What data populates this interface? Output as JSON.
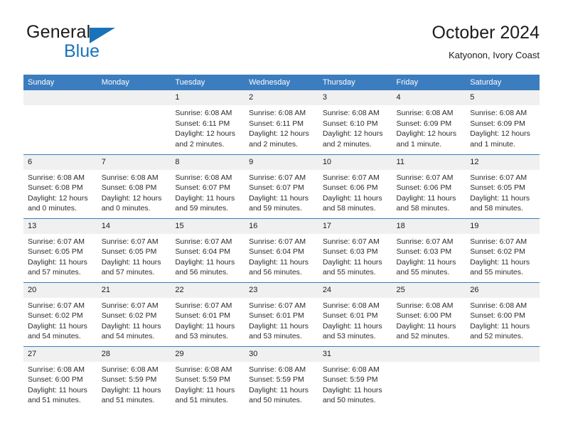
{
  "brand": {
    "name_part1": "General",
    "name_part2": "Blue",
    "triangle_color": "#1a72ba",
    "icon": "triangle-flag-icon"
  },
  "header": {
    "title": "October 2024",
    "subtitle": "Katyonon, Ivory Coast"
  },
  "theme": {
    "header_blue": "#3c7dbf",
    "daynum_band": "#f0f0f0",
    "text": "#1c1c1c"
  },
  "weekday_headers": [
    "Sunday",
    "Monday",
    "Tuesday",
    "Wednesday",
    "Thursday",
    "Friday",
    "Saturday"
  ],
  "weeks": [
    [
      {
        "day": "",
        "sunrise": "",
        "sunset": "",
        "daylight_line1": "",
        "daylight_line2": ""
      },
      {
        "day": "",
        "sunrise": "",
        "sunset": "",
        "daylight_line1": "",
        "daylight_line2": ""
      },
      {
        "day": "1",
        "sunrise": "Sunrise: 6:08 AM",
        "sunset": "Sunset: 6:11 PM",
        "daylight_line1": "Daylight: 12 hours",
        "daylight_line2": "and 2 minutes."
      },
      {
        "day": "2",
        "sunrise": "Sunrise: 6:08 AM",
        "sunset": "Sunset: 6:11 PM",
        "daylight_line1": "Daylight: 12 hours",
        "daylight_line2": "and 2 minutes."
      },
      {
        "day": "3",
        "sunrise": "Sunrise: 6:08 AM",
        "sunset": "Sunset: 6:10 PM",
        "daylight_line1": "Daylight: 12 hours",
        "daylight_line2": "and 2 minutes."
      },
      {
        "day": "4",
        "sunrise": "Sunrise: 6:08 AM",
        "sunset": "Sunset: 6:09 PM",
        "daylight_line1": "Daylight: 12 hours",
        "daylight_line2": "and 1 minute."
      },
      {
        "day": "5",
        "sunrise": "Sunrise: 6:08 AM",
        "sunset": "Sunset: 6:09 PM",
        "daylight_line1": "Daylight: 12 hours",
        "daylight_line2": "and 1 minute."
      }
    ],
    [
      {
        "day": "6",
        "sunrise": "Sunrise: 6:08 AM",
        "sunset": "Sunset: 6:08 PM",
        "daylight_line1": "Daylight: 12 hours",
        "daylight_line2": "and 0 minutes."
      },
      {
        "day": "7",
        "sunrise": "Sunrise: 6:08 AM",
        "sunset": "Sunset: 6:08 PM",
        "daylight_line1": "Daylight: 12 hours",
        "daylight_line2": "and 0 minutes."
      },
      {
        "day": "8",
        "sunrise": "Sunrise: 6:08 AM",
        "sunset": "Sunset: 6:07 PM",
        "daylight_line1": "Daylight: 11 hours",
        "daylight_line2": "and 59 minutes."
      },
      {
        "day": "9",
        "sunrise": "Sunrise: 6:07 AM",
        "sunset": "Sunset: 6:07 PM",
        "daylight_line1": "Daylight: 11 hours",
        "daylight_line2": "and 59 minutes."
      },
      {
        "day": "10",
        "sunrise": "Sunrise: 6:07 AM",
        "sunset": "Sunset: 6:06 PM",
        "daylight_line1": "Daylight: 11 hours",
        "daylight_line2": "and 58 minutes."
      },
      {
        "day": "11",
        "sunrise": "Sunrise: 6:07 AM",
        "sunset": "Sunset: 6:06 PM",
        "daylight_line1": "Daylight: 11 hours",
        "daylight_line2": "and 58 minutes."
      },
      {
        "day": "12",
        "sunrise": "Sunrise: 6:07 AM",
        "sunset": "Sunset: 6:05 PM",
        "daylight_line1": "Daylight: 11 hours",
        "daylight_line2": "and 58 minutes."
      }
    ],
    [
      {
        "day": "13",
        "sunrise": "Sunrise: 6:07 AM",
        "sunset": "Sunset: 6:05 PM",
        "daylight_line1": "Daylight: 11 hours",
        "daylight_line2": "and 57 minutes."
      },
      {
        "day": "14",
        "sunrise": "Sunrise: 6:07 AM",
        "sunset": "Sunset: 6:05 PM",
        "daylight_line1": "Daylight: 11 hours",
        "daylight_line2": "and 57 minutes."
      },
      {
        "day": "15",
        "sunrise": "Sunrise: 6:07 AM",
        "sunset": "Sunset: 6:04 PM",
        "daylight_line1": "Daylight: 11 hours",
        "daylight_line2": "and 56 minutes."
      },
      {
        "day": "16",
        "sunrise": "Sunrise: 6:07 AM",
        "sunset": "Sunset: 6:04 PM",
        "daylight_line1": "Daylight: 11 hours",
        "daylight_line2": "and 56 minutes."
      },
      {
        "day": "17",
        "sunrise": "Sunrise: 6:07 AM",
        "sunset": "Sunset: 6:03 PM",
        "daylight_line1": "Daylight: 11 hours",
        "daylight_line2": "and 55 minutes."
      },
      {
        "day": "18",
        "sunrise": "Sunrise: 6:07 AM",
        "sunset": "Sunset: 6:03 PM",
        "daylight_line1": "Daylight: 11 hours",
        "daylight_line2": "and 55 minutes."
      },
      {
        "day": "19",
        "sunrise": "Sunrise: 6:07 AM",
        "sunset": "Sunset: 6:02 PM",
        "daylight_line1": "Daylight: 11 hours",
        "daylight_line2": "and 55 minutes."
      }
    ],
    [
      {
        "day": "20",
        "sunrise": "Sunrise: 6:07 AM",
        "sunset": "Sunset: 6:02 PM",
        "daylight_line1": "Daylight: 11 hours",
        "daylight_line2": "and 54 minutes."
      },
      {
        "day": "21",
        "sunrise": "Sunrise: 6:07 AM",
        "sunset": "Sunset: 6:02 PM",
        "daylight_line1": "Daylight: 11 hours",
        "daylight_line2": "and 54 minutes."
      },
      {
        "day": "22",
        "sunrise": "Sunrise: 6:07 AM",
        "sunset": "Sunset: 6:01 PM",
        "daylight_line1": "Daylight: 11 hours",
        "daylight_line2": "and 53 minutes."
      },
      {
        "day": "23",
        "sunrise": "Sunrise: 6:07 AM",
        "sunset": "Sunset: 6:01 PM",
        "daylight_line1": "Daylight: 11 hours",
        "daylight_line2": "and 53 minutes."
      },
      {
        "day": "24",
        "sunrise": "Sunrise: 6:08 AM",
        "sunset": "Sunset: 6:01 PM",
        "daylight_line1": "Daylight: 11 hours",
        "daylight_line2": "and 53 minutes."
      },
      {
        "day": "25",
        "sunrise": "Sunrise: 6:08 AM",
        "sunset": "Sunset: 6:00 PM",
        "daylight_line1": "Daylight: 11 hours",
        "daylight_line2": "and 52 minutes."
      },
      {
        "day": "26",
        "sunrise": "Sunrise: 6:08 AM",
        "sunset": "Sunset: 6:00 PM",
        "daylight_line1": "Daylight: 11 hours",
        "daylight_line2": "and 52 minutes."
      }
    ],
    [
      {
        "day": "27",
        "sunrise": "Sunrise: 6:08 AM",
        "sunset": "Sunset: 6:00 PM",
        "daylight_line1": "Daylight: 11 hours",
        "daylight_line2": "and 51 minutes."
      },
      {
        "day": "28",
        "sunrise": "Sunrise: 6:08 AM",
        "sunset": "Sunset: 5:59 PM",
        "daylight_line1": "Daylight: 11 hours",
        "daylight_line2": "and 51 minutes."
      },
      {
        "day": "29",
        "sunrise": "Sunrise: 6:08 AM",
        "sunset": "Sunset: 5:59 PM",
        "daylight_line1": "Daylight: 11 hours",
        "daylight_line2": "and 51 minutes."
      },
      {
        "day": "30",
        "sunrise": "Sunrise: 6:08 AM",
        "sunset": "Sunset: 5:59 PM",
        "daylight_line1": "Daylight: 11 hours",
        "daylight_line2": "and 50 minutes."
      },
      {
        "day": "31",
        "sunrise": "Sunrise: 6:08 AM",
        "sunset": "Sunset: 5:59 PM",
        "daylight_line1": "Daylight: 11 hours",
        "daylight_line2": "and 50 minutes."
      },
      {
        "day": "",
        "sunrise": "",
        "sunset": "",
        "daylight_line1": "",
        "daylight_line2": ""
      },
      {
        "day": "",
        "sunrise": "",
        "sunset": "",
        "daylight_line1": "",
        "daylight_line2": ""
      }
    ]
  ]
}
